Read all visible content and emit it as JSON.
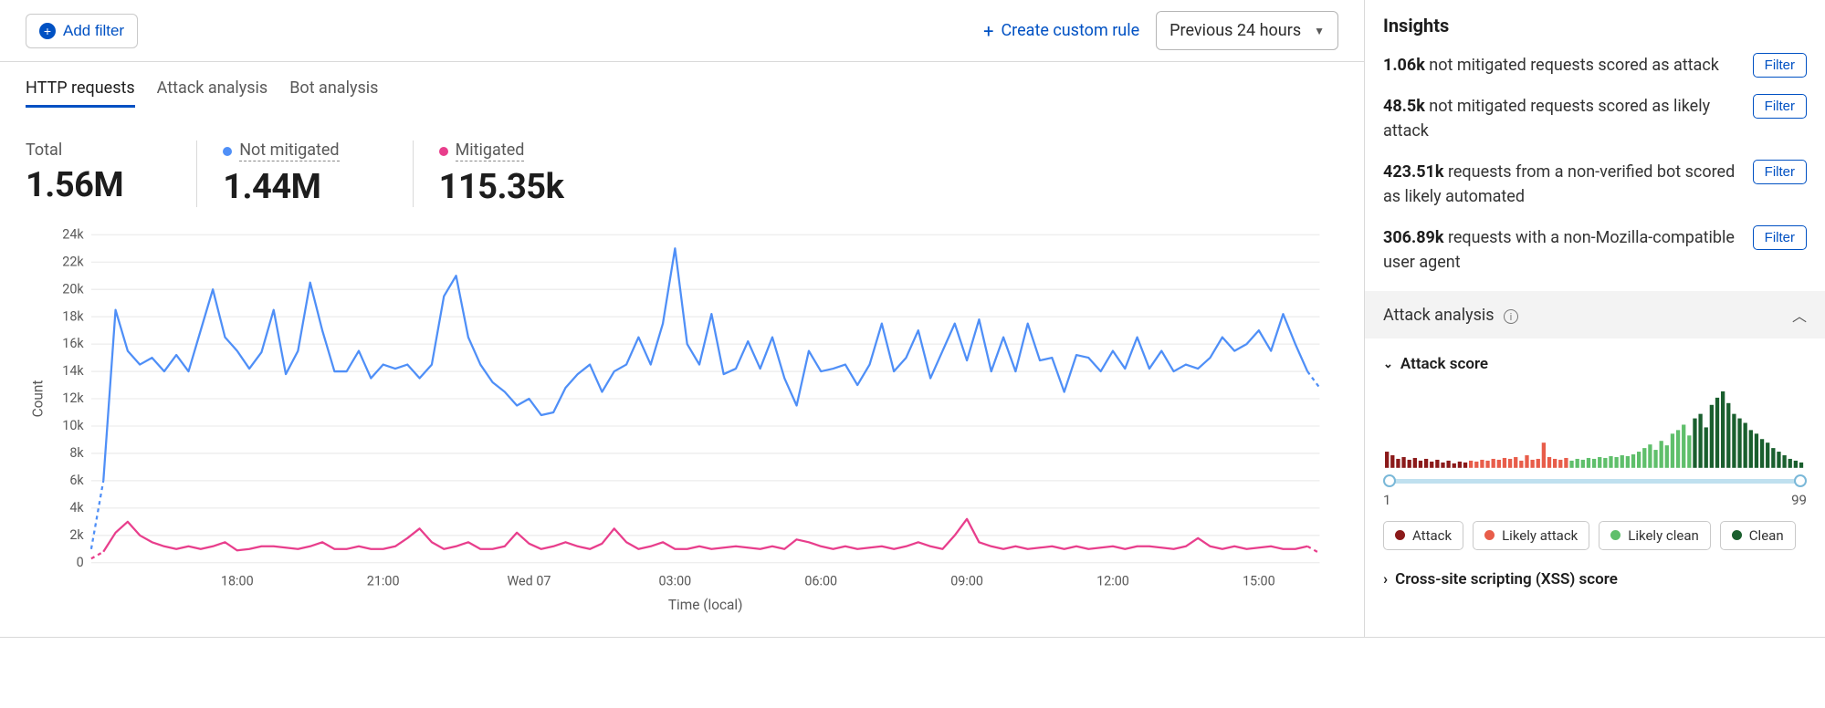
{
  "toolbar": {
    "add_filter": "Add filter",
    "create_rule": "Create custom rule",
    "time_range": "Previous 24 hours"
  },
  "tabs": [
    {
      "label": "HTTP requests",
      "active": true
    },
    {
      "label": "Attack analysis",
      "active": false
    },
    {
      "label": "Bot analysis",
      "active": false
    }
  ],
  "stats": {
    "total": {
      "label": "Total",
      "value": "1.56M"
    },
    "not_mitigated": {
      "label": "Not mitigated",
      "value": "1.44M",
      "color": "#4f8ff7"
    },
    "mitigated": {
      "label": "Mitigated",
      "value": "115.35k",
      "color": "#e83e8c"
    }
  },
  "chart_data": {
    "type": "line",
    "ylabel": "Count",
    "xlabel": "Time (local)",
    "ylim": [
      0,
      24000
    ],
    "y_ticks": [
      0,
      2000,
      4000,
      6000,
      8000,
      10000,
      12000,
      14000,
      16000,
      18000,
      20000,
      22000,
      24000
    ],
    "y_tick_labels": [
      "0",
      "2k",
      "4k",
      "6k",
      "8k",
      "10k",
      "12k",
      "14k",
      "16k",
      "18k",
      "20k",
      "22k",
      "24k"
    ],
    "x_ticks": [
      0,
      12,
      24,
      36,
      48,
      60,
      72,
      84,
      96
    ],
    "x_tick_labels": [
      "",
      "18:00",
      "21:00",
      "Wed 07",
      "03:00",
      "06:00",
      "09:00",
      "12:00",
      "15:00"
    ],
    "series": [
      {
        "name": "Not mitigated",
        "color": "#4f8ff7",
        "values": [
          1000,
          6000,
          18500,
          15500,
          14500,
          15000,
          14000,
          15200,
          14000,
          17000,
          20000,
          16500,
          15500,
          14200,
          15400,
          18500,
          13800,
          15500,
          20500,
          17000,
          14000,
          14000,
          15500,
          13500,
          14500,
          14200,
          14500,
          13500,
          14500,
          19500,
          21000,
          16500,
          14500,
          13200,
          12500,
          11500,
          12000,
          10800,
          11000,
          12800,
          13800,
          14500,
          12500,
          14000,
          14500,
          16500,
          14500,
          17500,
          23000,
          16000,
          14500,
          18200,
          13800,
          14200,
          16200,
          14200,
          16500,
          13500,
          11500,
          15500,
          14000,
          14200,
          14500,
          13000,
          14500,
          17500,
          14000,
          15000,
          17000,
          13500,
          15500,
          17500,
          14800,
          17800,
          14000,
          16500,
          14000,
          17500,
          14800,
          15000,
          12500,
          15200,
          15000,
          14000,
          15500,
          14200,
          16500,
          14200,
          15500,
          14000,
          14500,
          14200,
          15000,
          16500,
          15500,
          16000,
          17000,
          15500,
          18200,
          16000,
          14000,
          12800
        ]
      },
      {
        "name": "Mitigated",
        "color": "#e83e8c",
        "values": [
          300,
          800,
          2200,
          3000,
          2000,
          1500,
          1200,
          1000,
          1200,
          1000,
          1200,
          1500,
          900,
          1000,
          1200,
          1200,
          1100,
          1000,
          1200,
          1500,
          1000,
          1000,
          1200,
          1000,
          1000,
          1200,
          1800,
          2500,
          1500,
          1000,
          1200,
          1500,
          1000,
          1000,
          1200,
          2200,
          1400,
          1000,
          1200,
          1500,
          1200,
          1000,
          1400,
          2500,
          1500,
          1000,
          1200,
          1500,
          1000,
          1000,
          1200,
          1000,
          1100,
          1200,
          1100,
          1000,
          1200,
          1000,
          1700,
          1500,
          1200,
          1000,
          1200,
          1000,
          1100,
          1200,
          1000,
          1200,
          1500,
          1200,
          1000,
          2000,
          3200,
          1500,
          1200,
          1000,
          1200,
          1000,
          1100,
          1200,
          1000,
          1200,
          1000,
          1100,
          1200,
          1000,
          1200,
          1200,
          1100,
          1000,
          1200,
          1800,
          1200,
          1000,
          1200,
          1000,
          1100,
          1200,
          1000,
          1000,
          1200,
          700
        ]
      }
    ]
  },
  "insights": {
    "title": "Insights",
    "items": [
      {
        "count": "1.06k",
        "text": "not mitigated requests scored as attack"
      },
      {
        "count": "48.5k",
        "text": "not mitigated requests scored as likely attack"
      },
      {
        "count": "423.51k",
        "text": "requests from a non-verified bot scored as likely automated"
      },
      {
        "count": "306.89k",
        "text": "requests with a non-Mozilla-compatible user agent"
      }
    ],
    "filter_label": "Filter"
  },
  "attack_analysis": {
    "section_title": "Attack analysis",
    "attack_score": {
      "title": "Attack score",
      "slider_min": "1",
      "slider_max": "99",
      "legend": [
        {
          "label": "Attack",
          "color": "#8b1a1a"
        },
        {
          "label": "Likely attack",
          "color": "#e85d4a"
        },
        {
          "label": "Likely clean",
          "color": "#5fbf6b"
        },
        {
          "label": "Clean",
          "color": "#1a5f2e"
        }
      ]
    },
    "xss_title": "Cross-site scripting (XSS) score"
  },
  "histogram": {
    "buckets": 75,
    "values": [
      18,
      14,
      10,
      12,
      9,
      11,
      8,
      10,
      7,
      9,
      6,
      8,
      5,
      7,
      6,
      8,
      7,
      9,
      8,
      10,
      9,
      11,
      10,
      12,
      8,
      14,
      9,
      10,
      28,
      12,
      10,
      9,
      11,
      8,
      10,
      9,
      11,
      10,
      12,
      11,
      13,
      12,
      14,
      13,
      15,
      18,
      22,
      26,
      20,
      30,
      25,
      38,
      42,
      48,
      36,
      55,
      60,
      45,
      70,
      78,
      85,
      72,
      60,
      55,
      50,
      42,
      38,
      32,
      28,
      22,
      18,
      14,
      10,
      8,
      6
    ],
    "max": 85,
    "split_attack": 15,
    "split_likely_attack": 33,
    "split_likely_clean": 55
  }
}
